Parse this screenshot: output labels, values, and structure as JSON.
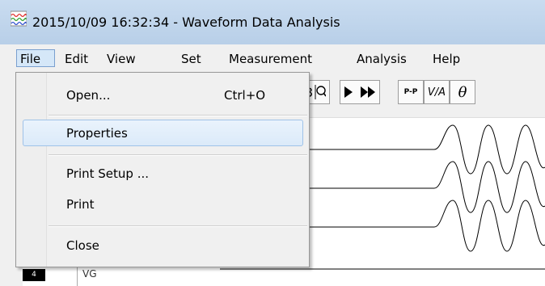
{
  "window": {
    "title": "2015/10/09 16:32:34  - Waveform Data Analysis"
  },
  "menubar": {
    "items": [
      "File",
      "Edit",
      "View",
      "Set",
      "Measurement",
      "Analysis",
      "Help"
    ]
  },
  "file_menu": {
    "open_label": "Open...",
    "open_shortcut": "Ctrl+O",
    "properties_label": "Properties",
    "print_setup_label": "Print Setup ...",
    "print_label": "Print",
    "close_label": "Close"
  },
  "toolbar": {
    "icons": [
      "zoom-out-icon",
      "zoom-icon",
      "play-icon",
      "fast-forward-icon",
      "peak-to-peak-icon",
      "voltage-amplitude-icon",
      "theta-phase-icon"
    ],
    "pp_text": "P-P",
    "va_text": "V/A",
    "theta_text": "θ"
  },
  "channels": {
    "number": "4",
    "label": "VG"
  },
  "colors": {
    "title_bar": "#c2d7ee",
    "menu_highlight": "#d5e7f8",
    "channel_badge": "#000000"
  }
}
